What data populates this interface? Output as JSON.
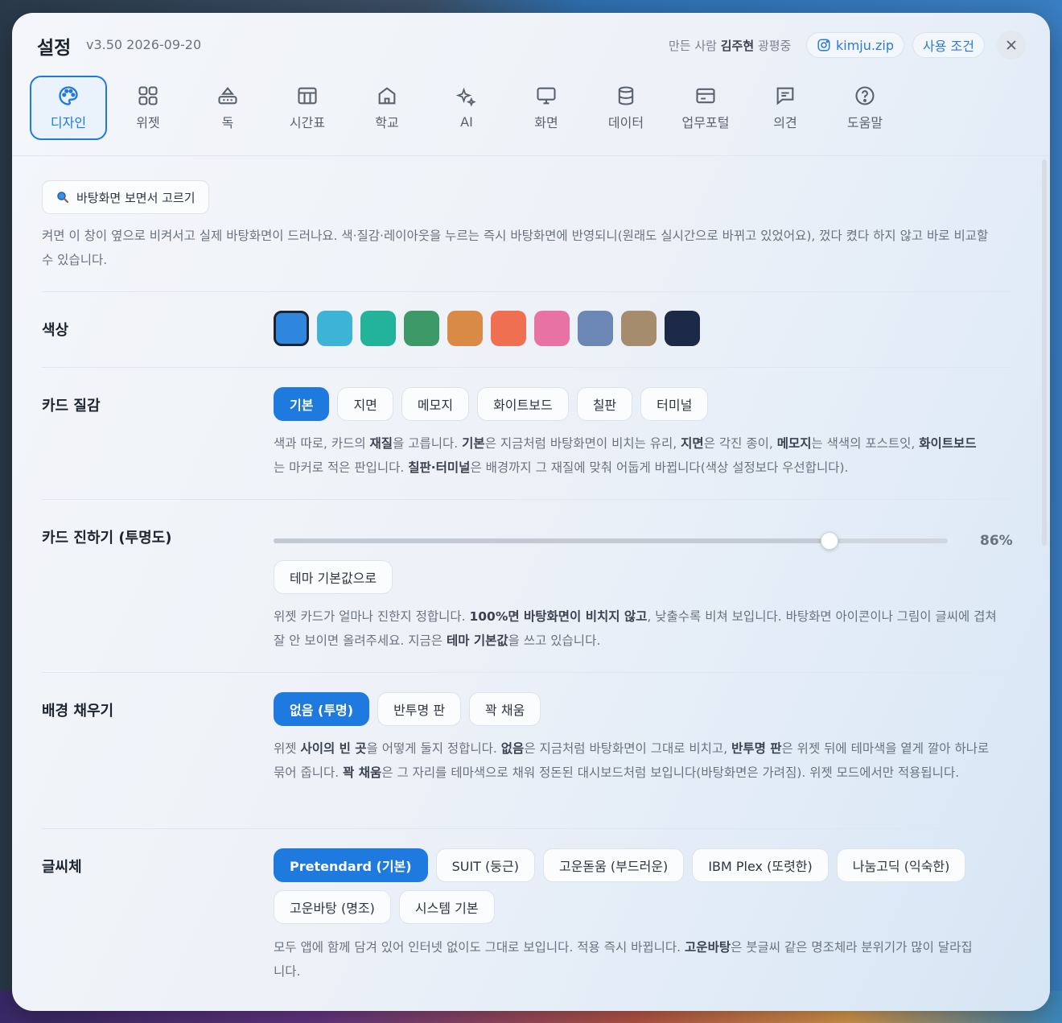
{
  "header": {
    "title": "설정",
    "version": "v3.50 2026-09-20",
    "maker_prefix": "만든 사람",
    "maker_name": "김주현",
    "maker_suffix": "광평중",
    "instagram": "kimju.zip",
    "terms": "사용 조건"
  },
  "tabs": [
    {
      "label": "디자인",
      "icon": "palette-icon",
      "active": true
    },
    {
      "label": "위젯",
      "icon": "grid-icon"
    },
    {
      "label": "독",
      "icon": "dock-icon"
    },
    {
      "label": "시간표",
      "icon": "table-icon"
    },
    {
      "label": "학교",
      "icon": "school-icon"
    },
    {
      "label": "AI",
      "icon": "sparkle-icon"
    },
    {
      "label": "화면",
      "icon": "monitor-icon"
    },
    {
      "label": "데이터",
      "icon": "database-icon"
    },
    {
      "label": "업무포털",
      "icon": "card-icon"
    },
    {
      "label": "의견",
      "icon": "message-icon"
    },
    {
      "label": "도움말",
      "icon": "help-icon"
    }
  ],
  "preview": {
    "button": "바탕화면 보면서 고르기",
    "desc": "켜면 이 창이 옆으로 비켜서고 실제 바탕화면이 드러나요. 색·질감·레이아웃을 누르는 즉시 바탕화면에 반영되니(원래도 실시간으로 바뀌고 있었어요), 껐다 켰다 하지 않고 바로 비교할 수 있습니다."
  },
  "color": {
    "label": "색상",
    "swatches": [
      "#2e86de",
      "#3db3d6",
      "#22b39a",
      "#3d9a68",
      "#d98a45",
      "#ee7050",
      "#e872a4",
      "#6b88b5",
      "#a58c6c",
      "#1c2a48"
    ],
    "selected": 0
  },
  "texture": {
    "label": "카드 질감",
    "options": [
      "기본",
      "지면",
      "메모지",
      "화이트보드",
      "칠판",
      "터미널"
    ],
    "active": 0,
    "desc_parts": [
      "색과 따로, 카드의 ",
      "재질",
      "을 고릅니다. ",
      "기본",
      "은 지금처럼 바탕화면이 비치는 유리, ",
      "지면",
      "은 각진 종이, ",
      "메모지",
      "는 색색의 포스트잇, ",
      "화이트보드",
      "는 마커로 적은 판입니다. ",
      "칠판·터미널",
      "은 배경까지 그 재질에 맞춰 어둡게 바뀝니다(색상 설정보다 우선합니다)."
    ]
  },
  "opacity": {
    "label": "카드 진하기 (투명도)",
    "value": 86,
    "value_label": "86%",
    "reset": "테마 기본값으로",
    "desc_parts": [
      "위젯 카드가 얼마나 진한지 정합니다. ",
      "100%면 바탕화면이 비치지 않고",
      ", 낮출수록 비쳐 보입니다. 바탕화면 아이콘이나 그림이 글씨에 겹쳐 잘 안 보이면 올려주세요. 지금은 ",
      "테마 기본값",
      "을 쓰고 있습니다."
    ]
  },
  "fill": {
    "label": "배경 채우기",
    "options": [
      "없음 (투명)",
      "반투명 판",
      "꽉 채움"
    ],
    "active": 0,
    "desc_parts": [
      "위젯 ",
      "사이의 빈 곳",
      "을 어떻게 둘지 정합니다. ",
      "없음",
      "은 지금처럼 바탕화면이 그대로 비치고, ",
      "반투명 판",
      "은 위젯 뒤에 테마색을 옅게 깔아 하나로 묶어 줍니다. ",
      "꽉 채움",
      "은 그 자리를 테마색으로 채워 정돈된 대시보드처럼 보입니다(바탕화면은 가려짐). 위젯 모드에서만 적용됩니다."
    ]
  },
  "font": {
    "label": "글씨체",
    "options": [
      "Pretendard (기본)",
      "SUIT (둥근)",
      "고운돋움 (부드러운)",
      "IBM Plex (또렷한)",
      "나눔고딕 (익숙한)",
      "고운바탕 (명조)",
      "시스템 기본"
    ],
    "active": 0,
    "desc_parts": [
      "모두 앱에 함께 담겨 있어 인터넷 없이도 그대로 보입니다. 적용 즉시 바뀝니다. ",
      "고운바탕",
      "은 붓글씨 같은 명조체라 분위기가 많이 달라집니다."
    ]
  }
}
